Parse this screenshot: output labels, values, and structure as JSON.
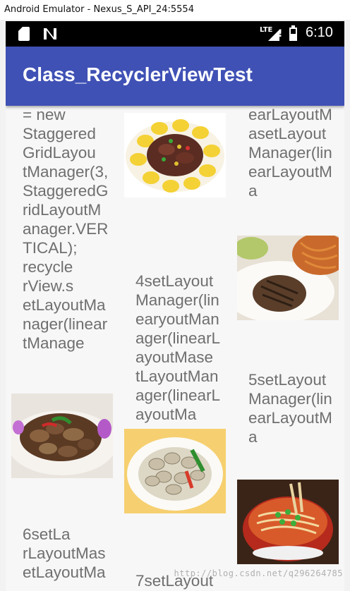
{
  "window": {
    "title": "Android Emulator - Nexus_S_API_24:5554"
  },
  "statusbar": {
    "time": "6:10",
    "network": "LTE",
    "icons": [
      "sd-card-icon",
      "n-icon",
      "signal-icon",
      "battery-icon"
    ]
  },
  "appbar": {
    "title": "Class_RecyclerViewTest",
    "color": "#3f51b5"
  },
  "items": {
    "col1_text_a": "= new\nStaggered\nGridLayou\ntManager(3,\nStaggeredG\nridLayoutM\nanager.VER\nTICAL);\nrecycle\nrView.s\netLayoutMa\nnager(linear\ntManage",
    "col1_text_b": "6setLa\nrLayoutMas\netLayoutMa",
    "col2_text_a": "4setLayout\nManager(lin\nearyoutMan\nager(linearL\nayoutMase\ntLayoutMan\nager(linearL\nayoutMa",
    "col2_text_b": "7setLayout",
    "col3_text_a": "earLayoutM\nasetLayout\nManager(lin\nearLayoutM\na",
    "col3_text_b": "5setLayout\nManager(lin\nearLayoutM\na"
  },
  "images": [
    "food-image-corn-beef",
    "food-image-steak-pasta",
    "food-image-clams-dish",
    "food-image-clams-plate",
    "food-image-noodle-bowl"
  ],
  "watermark": "http://blog.csdn.net/q296264785"
}
